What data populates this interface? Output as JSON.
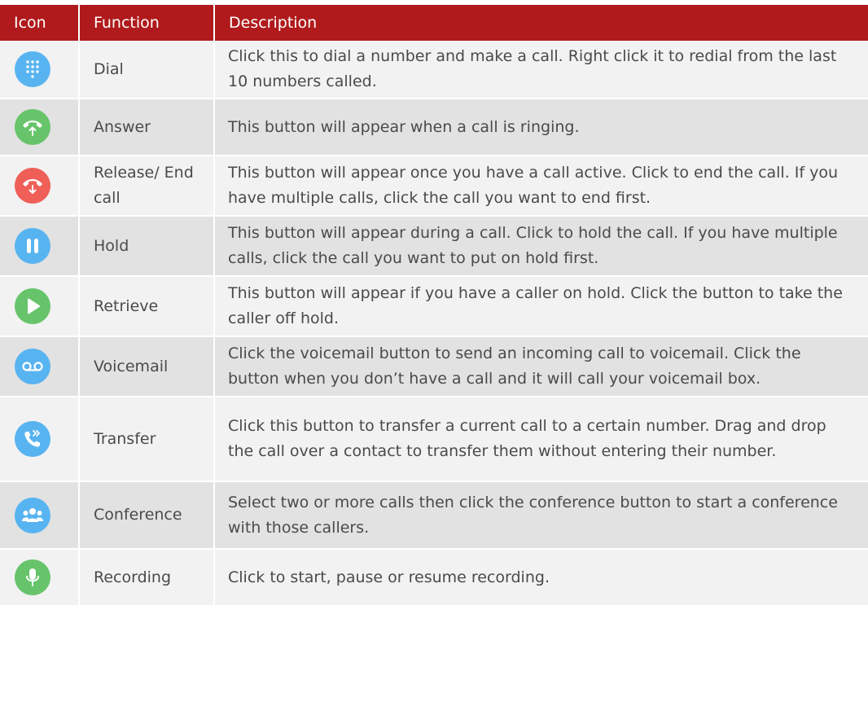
{
  "colors": {
    "header_bg": "#b01a1c",
    "row_light": "#f2f2f2",
    "row_dark": "#e2e2e2",
    "icon_blue": "#58b4f0",
    "icon_green": "#67c46b",
    "icon_red": "#ef5f58"
  },
  "header": {
    "icon": "Icon",
    "function": "Function",
    "description": "Description"
  },
  "rows": [
    {
      "icon": "dialpad-icon",
      "function": "Dial",
      "description": "Click this to dial a number and make a call. Right click it to redial from the last 10 numbers called."
    },
    {
      "icon": "answer-phone-icon",
      "function": "Answer",
      "description": "This button will appear when a call is ringing."
    },
    {
      "icon": "release-phone-icon",
      "function": "Release/ End call",
      "description": "This button will appear once you have a call active. Click to end the call. If you have multiple calls, click the call you want to end first."
    },
    {
      "icon": "pause-icon",
      "function": "Hold",
      "description": "This button will appear during a call. Click to hold the call. If you have multiple calls, click the call you want to put on hold first."
    },
    {
      "icon": "play-icon",
      "function": "Retrieve",
      "description": "This button will appear if you have a caller on hold. Click the button to take the caller off hold."
    },
    {
      "icon": "voicemail-icon",
      "function": "Voicemail",
      "description": "Click the voicemail button to send an incoming call to voicemail. Click the button when you don’t have a call and it will call your voicemail box."
    },
    {
      "icon": "transfer-icon",
      "function": "Transfer",
      "description": "Click this button to transfer a current call to a certain number. Drag and drop the call over a contact to transfer them without entering their number."
    },
    {
      "icon": "conference-icon",
      "function": "Conference",
      "description": "Select two or more calls then click the conference button to start a conference with those callers."
    },
    {
      "icon": "microphone-icon",
      "function": "Recording",
      "description": "Click to start, pause or resume recording."
    }
  ]
}
